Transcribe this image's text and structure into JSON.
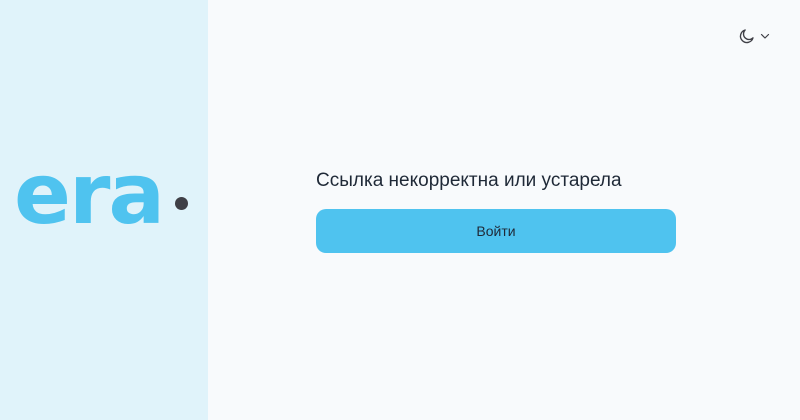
{
  "brand": {
    "logo_text": "era",
    "logo_color": "#4fc3ef",
    "dot_color": "#3f3f46",
    "panel_bg": "#e0f3fa"
  },
  "header": {
    "theme_icon": "moon-icon",
    "dropdown_icon": "chevron-down-icon"
  },
  "main": {
    "message": "Ссылка некорректна или устарела",
    "login_label": "Войти",
    "accent_color": "#4fc3ef"
  }
}
